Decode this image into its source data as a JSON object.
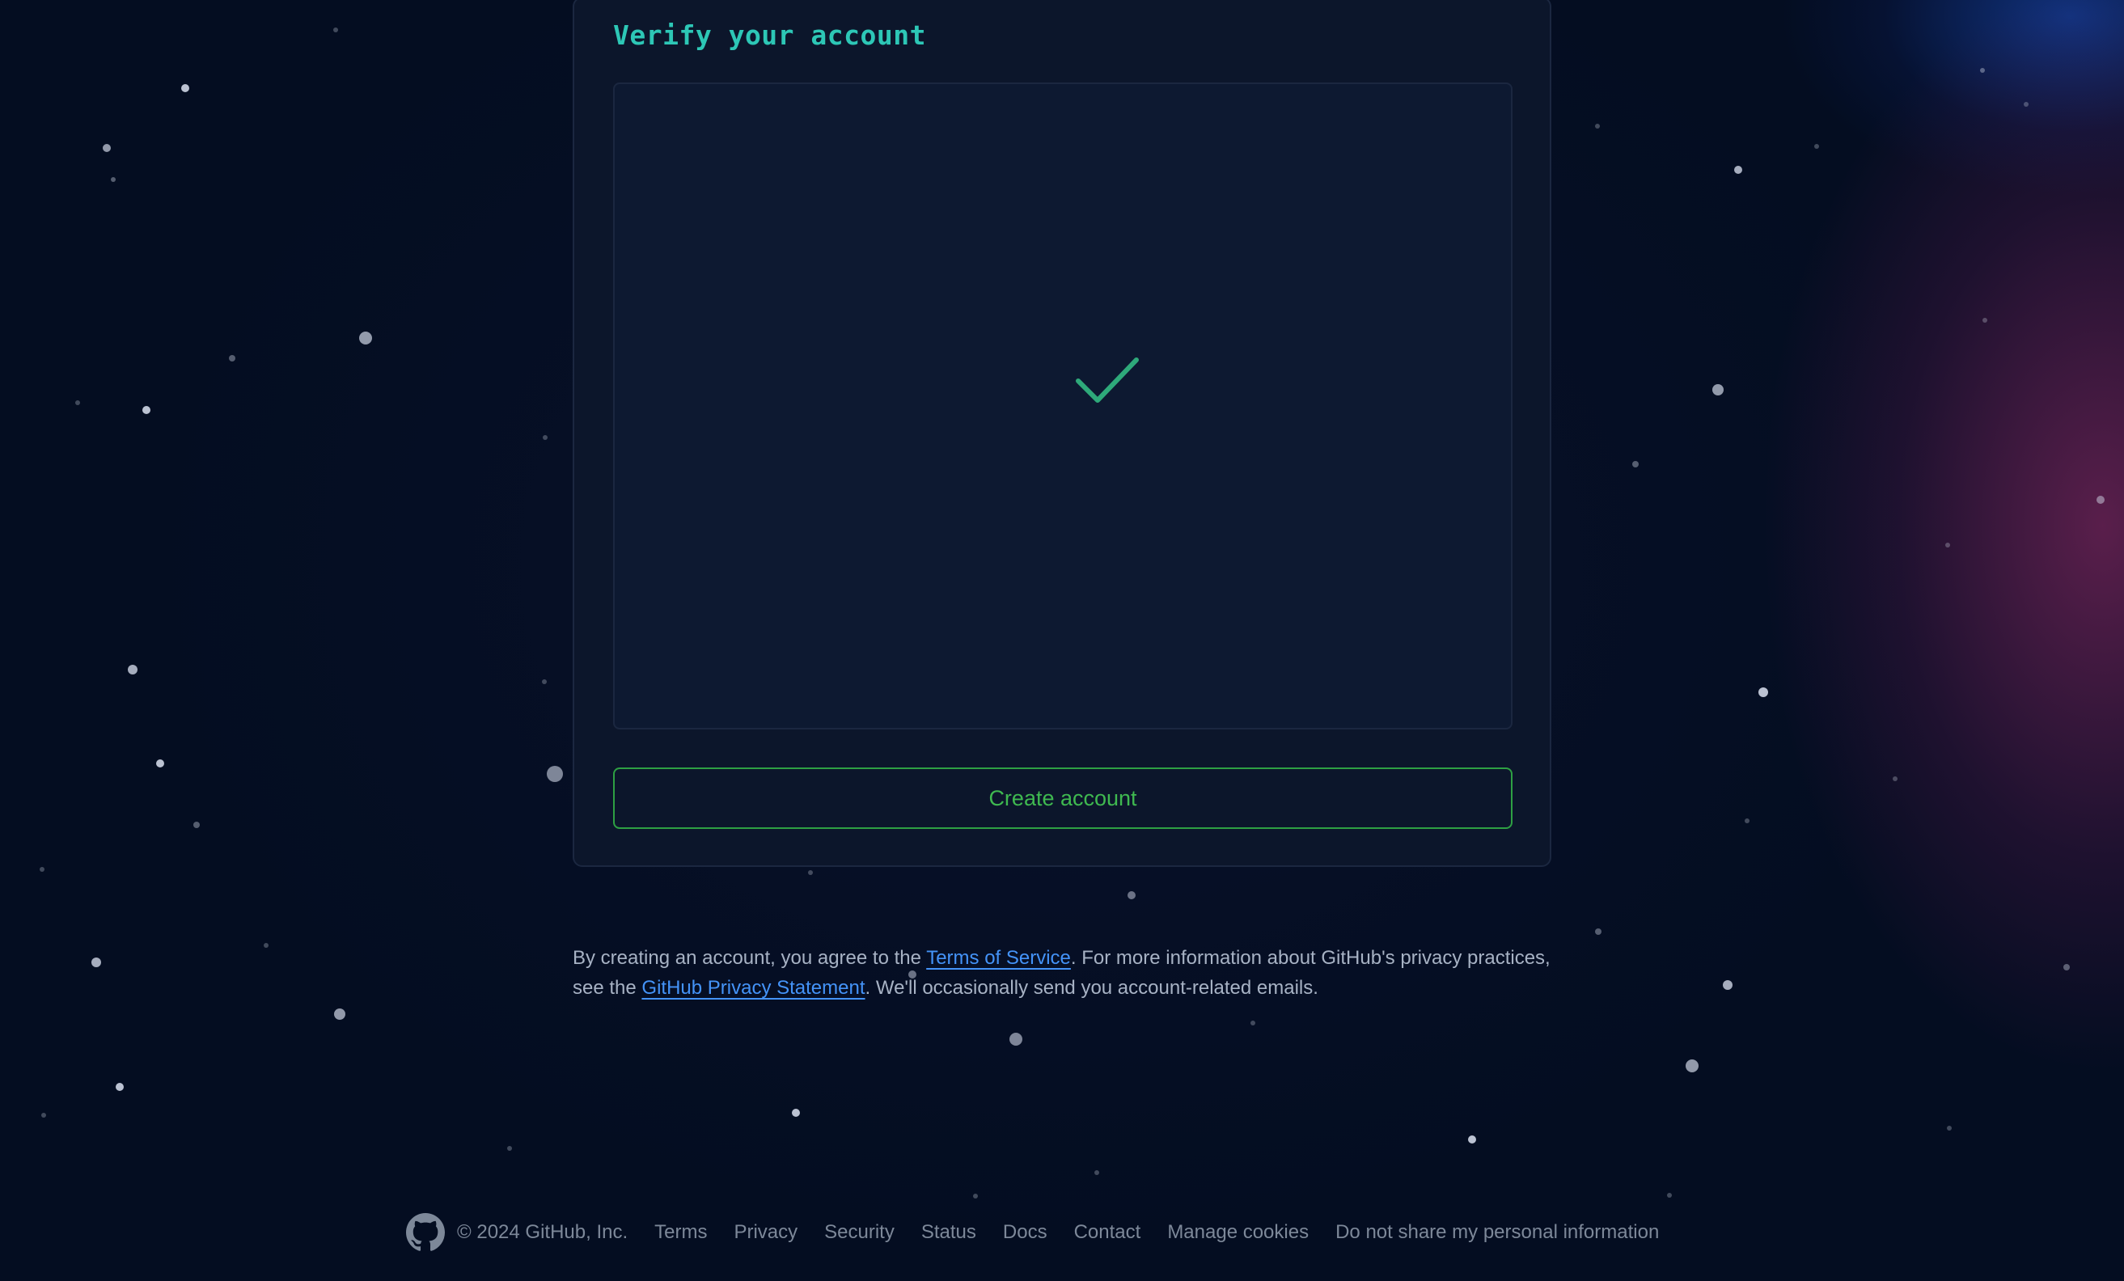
{
  "verify": {
    "title": "Verify your account",
    "status_icon": "checkmark-icon"
  },
  "actions": {
    "create_account_label": "Create account"
  },
  "legal": {
    "text_before_terms": "By creating an account, you agree to the ",
    "terms_link": "Terms of Service",
    "text_after_terms": ". For more information about GitHub's privacy practices, see the ",
    "privacy_link": "GitHub Privacy Statement",
    "text_end": ". We'll occasionally send you account-related emails."
  },
  "footer": {
    "logo_icon": "github-logo-icon",
    "copyright": "© 2024 GitHub, Inc.",
    "links": [
      "Terms",
      "Privacy",
      "Security",
      "Status",
      "Docs",
      "Contact",
      "Manage cookies",
      "Do not share my personal information"
    ]
  },
  "colors": {
    "background": "#040d21",
    "accent_title": "#2dc7b6",
    "button_border": "#2ea043",
    "button_text": "#3fb950",
    "link": "#4493f8",
    "check": "#2ea97a"
  }
}
